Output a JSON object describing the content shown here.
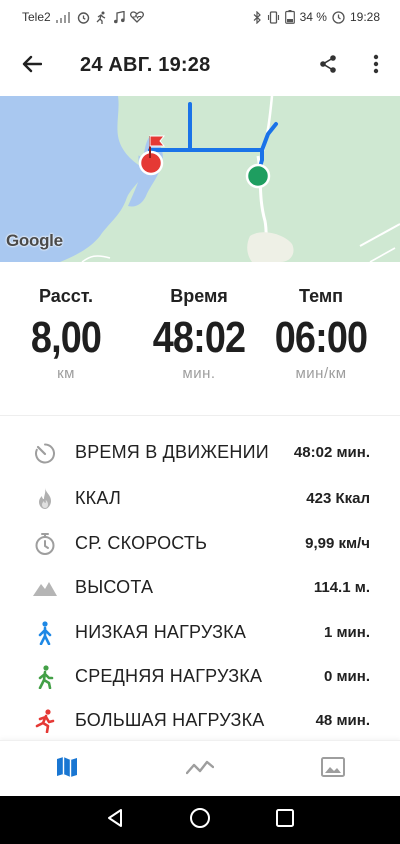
{
  "status_bar": {
    "carrier": "Tele2",
    "battery": "34 %",
    "time": "19:28"
  },
  "app_bar": {
    "title": "24 АВГ. 19:28"
  },
  "map": {
    "attribution": "Google",
    "route_color": "#1a73e8",
    "start_marker_color": "#1e9e60",
    "finish_marker_color": "#e53935",
    "water_color": "#a9c8f0",
    "land_color": "#cfe8d2"
  },
  "summary": [
    {
      "label": "Расст.",
      "value": "8,00",
      "unit": "км"
    },
    {
      "label": "Время",
      "value": "48:02",
      "unit": "мин."
    },
    {
      "label": "Темп",
      "value": "06:00",
      "unit": "мин/км"
    }
  ],
  "details": [
    {
      "icon": "stopwatch-icon",
      "label": "ВРЕМЯ В ДВИЖЕНИИ",
      "value": "48:02 мин."
    },
    {
      "icon": "flame-icon",
      "label": "ККАЛ",
      "value": "423 Ккал"
    },
    {
      "icon": "timer-icon",
      "label": "СР. СКОРОСТЬ",
      "value": "9,99 км/ч"
    },
    {
      "icon": "mountain-icon",
      "label": "ВЫСОТА",
      "value": "114.1 м."
    },
    {
      "icon": "walking-person-icon",
      "label": "НИЗКАЯ НАГРУЗКА",
      "value": "1 мин."
    },
    {
      "icon": "hiking-person-icon",
      "label": "СРЕДНЯЯ НАГРУЗКА",
      "value": "0 мин."
    },
    {
      "icon": "running-person-icon",
      "label": "БОЛЬШАЯ НАГРУЗКА",
      "value": "48 мин."
    }
  ],
  "bottom_nav": [
    {
      "icon": "map-icon",
      "active": true
    },
    {
      "icon": "chart-line-icon",
      "active": false
    },
    {
      "icon": "photo-icon",
      "active": false
    }
  ],
  "colors": {
    "accent": "#1976d2",
    "low_load": "#1e88e5",
    "medium_load": "#43a047",
    "high_load": "#e53935",
    "muted_icon": "#9e9e9e"
  }
}
